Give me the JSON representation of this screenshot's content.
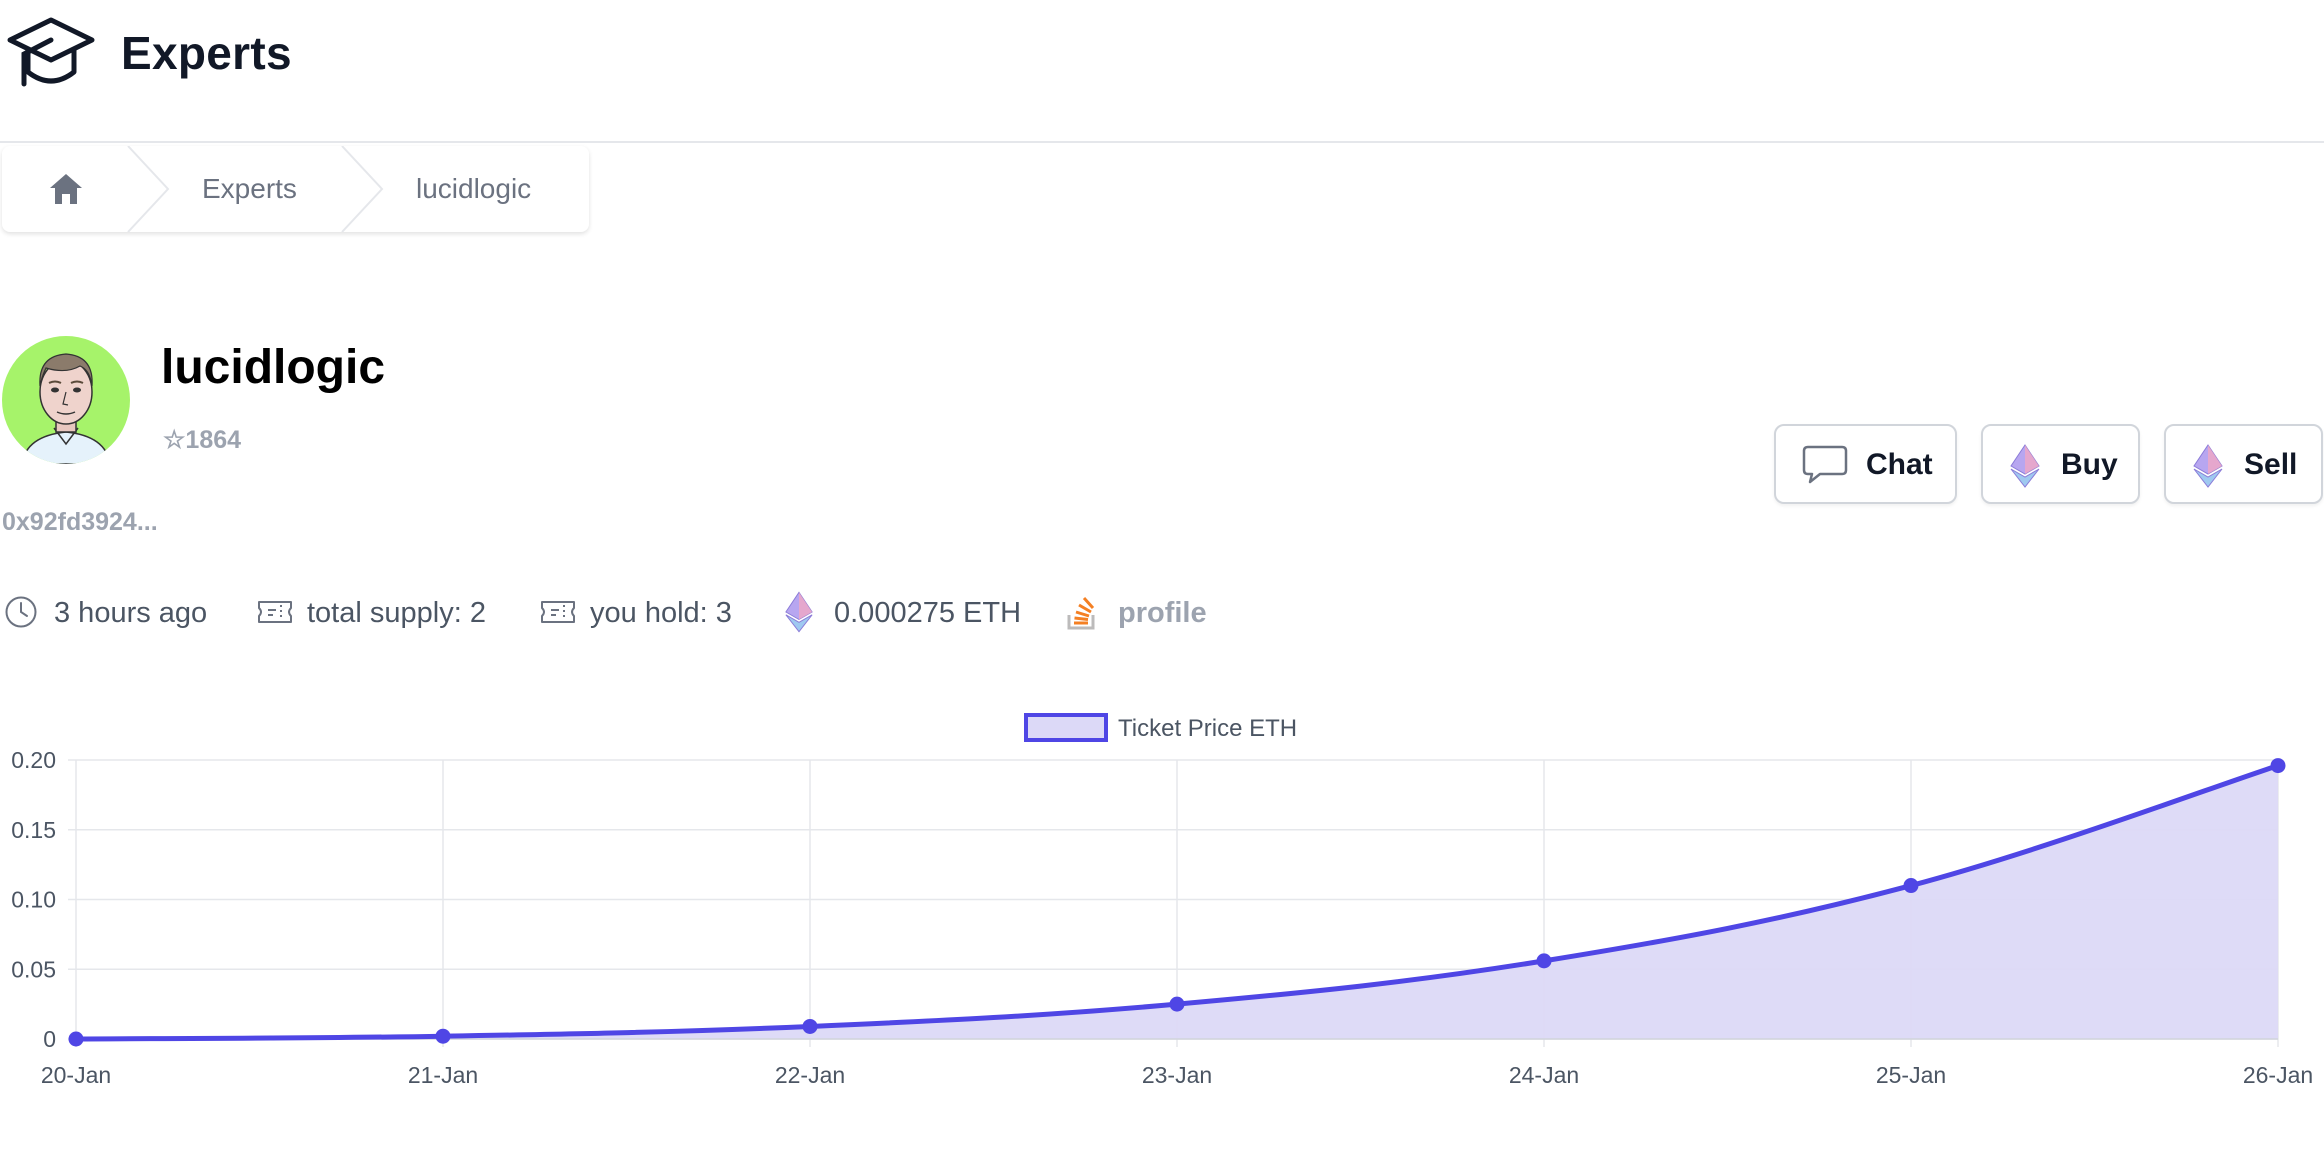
{
  "app": {
    "title": "Experts",
    "logo_icon": "graduation-cap-icon"
  },
  "breadcrumb": {
    "home_icon": "home-icon",
    "items": [
      "Experts",
      "lucidlogic"
    ]
  },
  "profile": {
    "name": "lucidlogic",
    "stars": "☆1864",
    "address": "0x92fd3924...",
    "avatar": "avatar-image"
  },
  "actions": {
    "chat": "Chat",
    "buy": "Buy",
    "sell": "Sell"
  },
  "meta": {
    "time": "3 hours ago",
    "supply": "total supply: 2",
    "hold": "you hold: 3",
    "price": "0.000275 ETH",
    "profile_link": "profile"
  },
  "colors": {
    "accent": "#4f46e5",
    "accent_fill": "#dcd9f7",
    "muted": "#9ca3af",
    "stackoverflow": "#f48024"
  },
  "chart_data": {
    "type": "area",
    "x": [
      "20-Jan",
      "21-Jan",
      "22-Jan",
      "23-Jan",
      "24-Jan",
      "25-Jan",
      "26-Jan"
    ],
    "series": [
      {
        "name": "Ticket Price ETH",
        "values": [
          0.0,
          0.002,
          0.009,
          0.025,
          0.056,
          0.11,
          0.196
        ]
      }
    ],
    "y_ticks": [
      "0",
      "0.05",
      "0.10",
      "0.15",
      "0.20"
    ],
    "ylim": [
      0,
      0.2
    ],
    "grid": true,
    "legend": "top-center"
  }
}
